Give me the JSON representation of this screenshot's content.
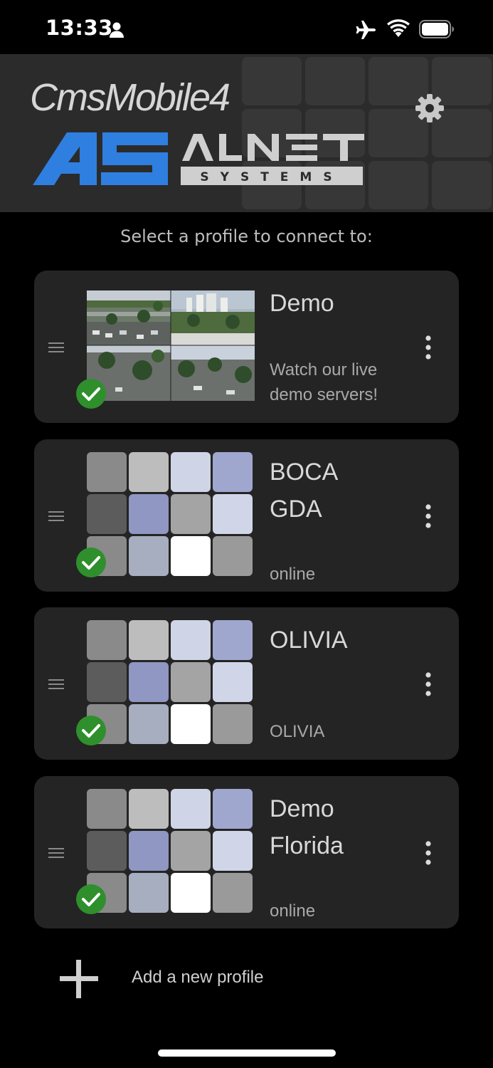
{
  "status_bar": {
    "time": "13:33"
  },
  "header": {
    "app_title": "CmsMobile4",
    "logo_text": "AS ALNET SYSTEMS",
    "accent_color": "#2f7fe0"
  },
  "prompt": "Select a profile to connect to:",
  "profiles": [
    {
      "title_lines": [
        "Demo"
      ],
      "subtitle_lines": [
        "Watch our live",
        "demo servers!"
      ],
      "thumbnail": "camera-photos",
      "connected": true
    },
    {
      "title_lines": [
        "BOCA",
        "GDA"
      ],
      "subtitle_lines": [
        "online"
      ],
      "thumbnail": "grid",
      "connected": true
    },
    {
      "title_lines": [
        "OLIVIA"
      ],
      "subtitle_lines": [
        "OLIVIA"
      ],
      "thumbnail": "grid",
      "connected": true
    },
    {
      "title_lines": [
        "Demo",
        "Florida"
      ],
      "subtitle_lines": [
        "online"
      ],
      "thumbnail": "grid",
      "connected": true
    }
  ],
  "add_profile_label": "Add a new profile",
  "colors": {
    "check_green": "#2f8f2c",
    "card_bg": "#242424",
    "header_bg": "#2b2b2b"
  }
}
